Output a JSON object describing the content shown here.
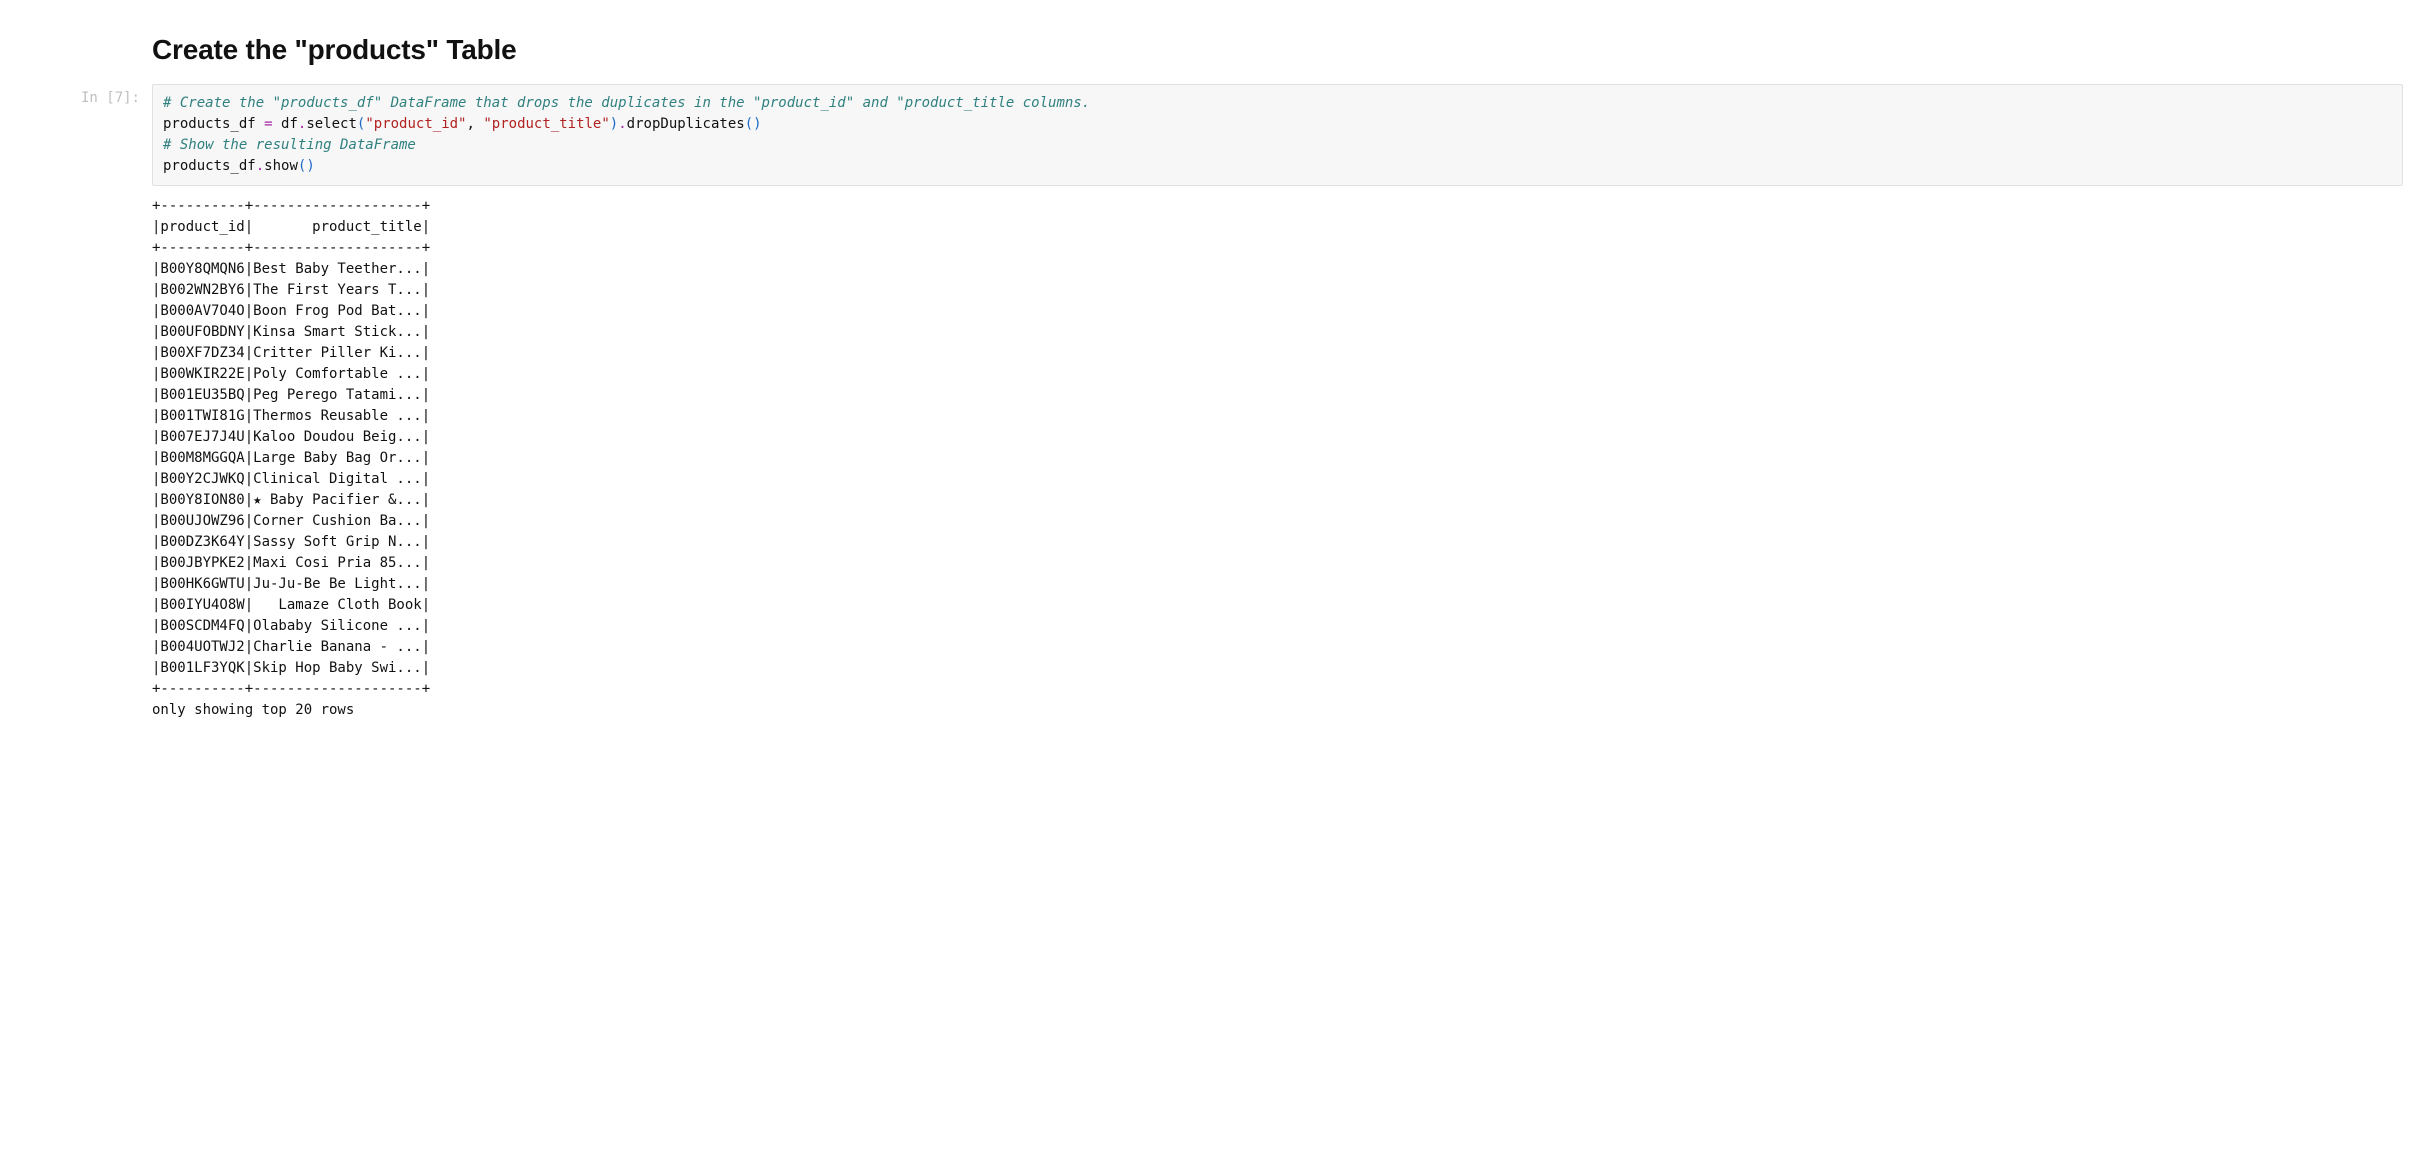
{
  "heading": "Create the \"products\" Table",
  "prompt_label": "In [7]:",
  "code": {
    "comment1": "# Create the \"products_df\" DataFrame that drops the duplicates in the \"product_id\" and \"product_title columns.",
    "line2_lhs": "products_df ",
    "line2_eq": "=",
    "line2_rhs1": " df",
    "line2_dot1": ".",
    "line2_select": "select",
    "line2_open1": "(",
    "line2_str1": "\"product_id\"",
    "line2_comma": ", ",
    "line2_str2": "\"product_title\"",
    "line2_close1": ")",
    "line2_dot2": ".",
    "line2_drop": "dropDuplicates",
    "line2_open2": "(",
    "line2_close2": ")",
    "comment2": "# Show the resulting DataFrame",
    "line4_lhs": "products_df",
    "line4_dot": ".",
    "line4_show": "show",
    "line4_open": "(",
    "line4_close": ")"
  },
  "output_text": "+----------+--------------------+\n|product_id|       product_title|\n+----------+--------------------+\n|B00Y8QMQN6|Best Baby Teether...|\n|B002WN2BY6|The First Years T...|\n|B000AV7O4O|Boon Frog Pod Bat...|\n|B00UFOBDNY|Kinsa Smart Stick...|\n|B00XF7DZ34|Critter Piller Ki...|\n|B00WKIR22E|Poly Comfortable ...|\n|B001EU35BQ|Peg Perego Tatami...|\n|B001TWI81G|Thermos Reusable ...|\n|B007EJ7J4U|Kaloo Doudou Beig...|\n|B00M8MGGQA|Large Baby Bag Or...|\n|B00Y2CJWKQ|Clinical Digital ...|\n|B00Y8ION80|★ Baby Pacifier &...|\n|B00UJOWZ96|Corner Cushion Ba...|\n|B00DZ3K64Y|Sassy Soft Grip N...|\n|B00JBYPKE2|Maxi Cosi Pria 85...|\n|B00HK6GWTU|Ju-Ju-Be Be Light...|\n|B00IYU4O8W|   Lamaze Cloth Book|\n|B00SCDM4FQ|Olababy Silicone ...|\n|B004UOTWJ2|Charlie Banana - ...|\n|B001LF3YQK|Skip Hop Baby Swi...|\n+----------+--------------------+\nonly showing top 20 rows\n"
}
